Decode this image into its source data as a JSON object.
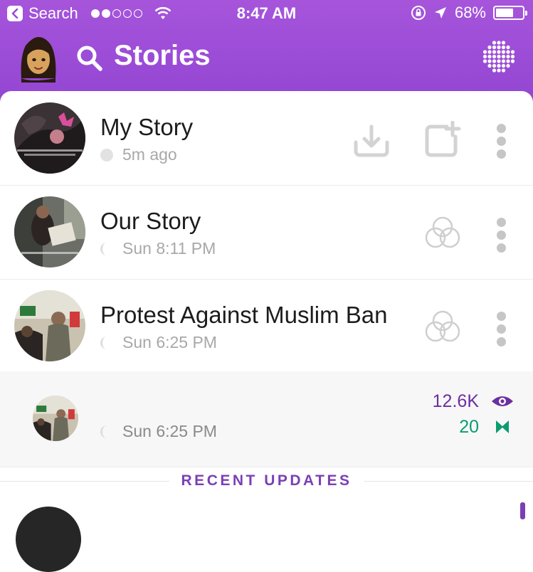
{
  "status_bar": {
    "back_label": "Search",
    "time": "8:47 AM",
    "battery": "68%",
    "battery_level": 0.68
  },
  "header": {
    "title": "Stories"
  },
  "stories": [
    {
      "title": "My Story",
      "subtitle": "5m ago",
      "status": "full-circle"
    },
    {
      "title": "Our Story",
      "subtitle": "Sun 8:11 PM",
      "status": "half-circle"
    },
    {
      "title": "Protest Against Muslim Ban",
      "subtitle": "Sun 6:25 PM",
      "status": "half-circle"
    }
  ],
  "snap_item": {
    "subtitle": "Sun 6:25 PM",
    "views": "12.6K",
    "screenshots": "20"
  },
  "section": {
    "label": "RECENT UPDATES"
  },
  "colors": {
    "header_purple": "#9b4cd6",
    "views_purple": "#6b2fa0",
    "screenshots_teal": "#0b9c6e"
  }
}
